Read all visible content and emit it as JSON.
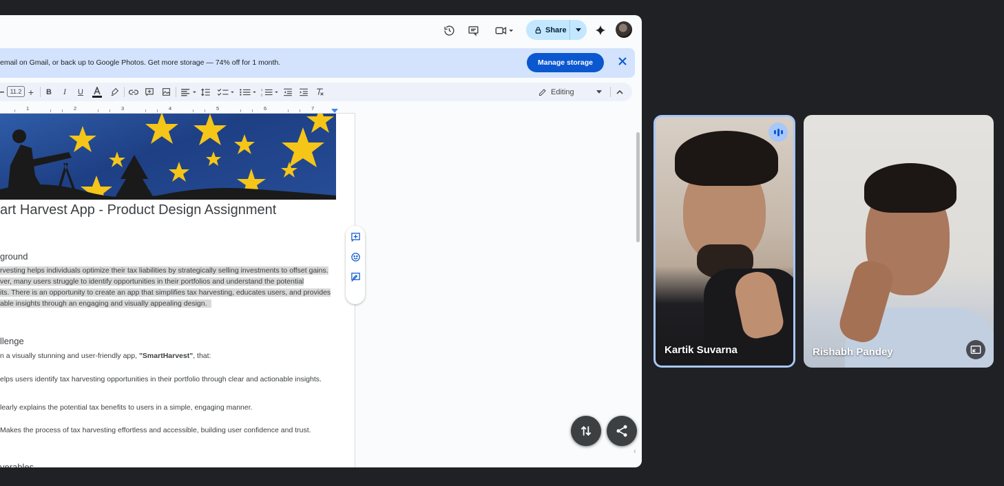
{
  "doc": {
    "share_label": "Share",
    "banner_text": "email on Gmail, or back up to Google Photos. Get more storage — 74% off for 1 month.",
    "manage_storage_label": "Manage storage",
    "font_size": "11.2",
    "editing_label": "Editing",
    "ruler_numbers": [
      "1",
      "2",
      "3",
      "4",
      "5",
      "6",
      "7"
    ],
    "title": "art Harvest App - Product Design Assignment",
    "background_heading": "ground",
    "background_lines": [
      "rvesting helps individuals optimize their tax liabilities by strategically selling investments to offset gains.",
      "ver, many users struggle to identify opportunities in their portfolios and understand the potential",
      "its. There is an opportunity to create an app that simplifies tax harvesting, educates users, and provides",
      "able insights through an engaging and visually appealing design."
    ],
    "challenge_heading": "llenge",
    "challenge_intro_prefix": "n a visually stunning and user-friendly app, ",
    "challenge_intro_app": "\"SmartHarvest\"",
    "challenge_intro_suffix": ", that:",
    "bullets": [
      "elps users identify tax harvesting opportunities in their portfolio through clear and actionable insights.",
      "learly explains the potential tax benefits to users in a simple, engaging manner.",
      "Makes the process of tax harvesting effortless and accessible, building user confidence and trust."
    ],
    "deliverables_heading": "verables"
  },
  "participants": [
    {
      "name": "Kartik Suvarna",
      "speaking": true
    },
    {
      "name": "Rishabh Pandey",
      "speaking": false
    }
  ],
  "colors": {
    "accent": "#0b57d0",
    "share_bg": "#c2e7ff",
    "banner_bg": "#d3e3fd",
    "speaking_border": "#a8c7fa"
  }
}
